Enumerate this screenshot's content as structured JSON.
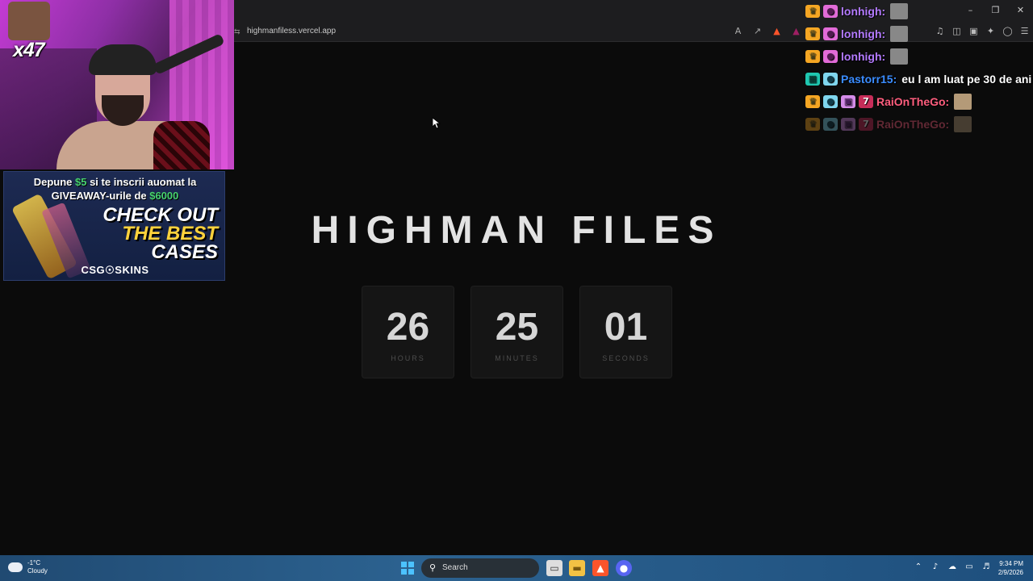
{
  "browser": {
    "url": "highmanfiless.vercel.app"
  },
  "webcam": {
    "emote_multiplier": "x47"
  },
  "ad": {
    "line1_prefix": "Depune ",
    "line1_amount": "$5",
    "line1_suffix": " si te inscrii auomat la",
    "line2_prefix": "GIVEAWAY-urile de ",
    "line2_amount": "$6000",
    "headline_1": "CHECK OUT",
    "headline_2": "THE BEST",
    "headline_3": "CASES",
    "brand": "CSG☉SKINS"
  },
  "chat": {
    "messages": [
      {
        "user": "lonhigh:",
        "text": ""
      },
      {
        "user": "lonhigh:",
        "text": ""
      },
      {
        "user": "lonhigh:",
        "text": ""
      },
      {
        "user": "Pastorr15:",
        "text": "eu l am luat pe 30 de ani"
      },
      {
        "user": "RaiOnTheGo:",
        "text": ""
      },
      {
        "user": "RaiOnTheGo:",
        "text": ""
      }
    ]
  },
  "page": {
    "title": "HIGHMAN FILES",
    "countdown": [
      {
        "value": "26",
        "label": "HOURS"
      },
      {
        "value": "25",
        "label": "MINUTES"
      },
      {
        "value": "01",
        "label": "SECONDS"
      }
    ]
  },
  "taskbar": {
    "temperature": "-1°C",
    "weather": "Cloudy",
    "search_label": "Search",
    "time": "9:34 PM",
    "date": "2/9/2026"
  },
  "colors": {
    "background": "#0b0b0b",
    "timer_box": "#151515",
    "accent_green": "#47d16f",
    "taskbar": "#2c6290"
  }
}
